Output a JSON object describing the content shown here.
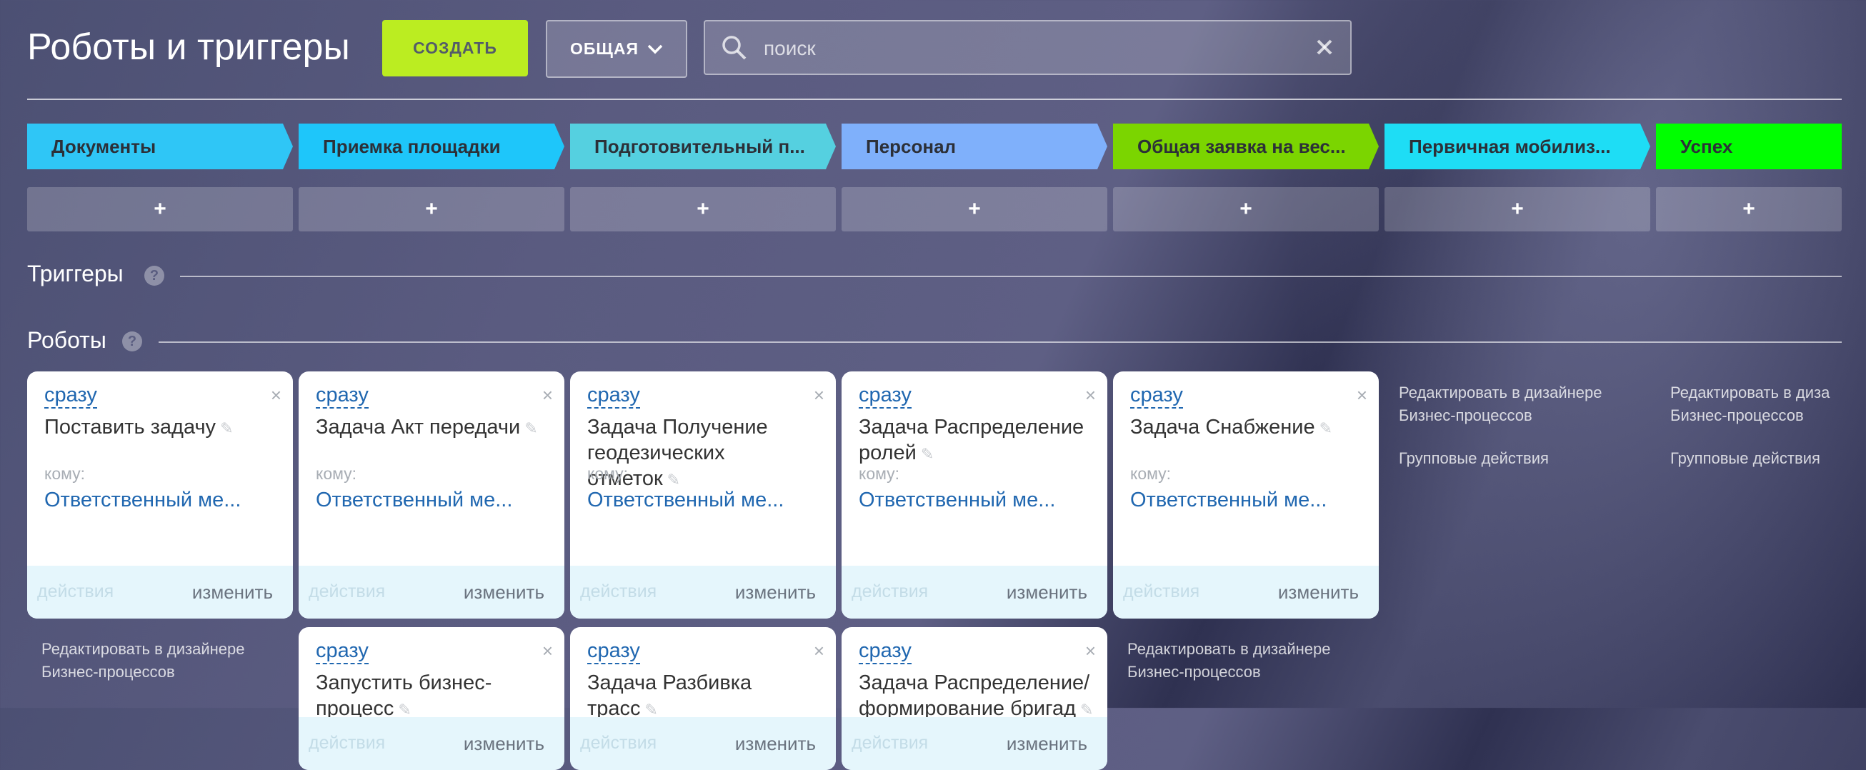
{
  "header": {
    "title": "Роботы и триггеры",
    "create_label": "СОЗДАТЬ",
    "general_label": "ОБЩАЯ",
    "search_placeholder": "поиск"
  },
  "stages": [
    {
      "label": "Документы",
      "color": "#2fc6f6"
    },
    {
      "label": "Приемка площадки",
      "color": "#1ec6fa"
    },
    {
      "label": "Подготовительный п...",
      "color": "#55d0e0"
    },
    {
      "label": "Персонал",
      "color": "#7fb0fb"
    },
    {
      "label": "Общая заявка на вес...",
      "color": "#7bd500"
    },
    {
      "label": "Первичная мобилиз...",
      "color": "#1eddf5"
    },
    {
      "label": "Успех",
      "color": "#00ff00"
    }
  ],
  "add_label": "+",
  "sections": {
    "triggers": "Триггеры",
    "robots": "Роботы",
    "help": "?"
  },
  "card_common": {
    "when": "сразу",
    "to_label": "кому:",
    "responsible": "Ответственный ме...",
    "actions": "действия",
    "edit": "изменить",
    "close": "×"
  },
  "robots_row1": [
    {
      "name": "Поставить задачу"
    },
    {
      "name": "Задача Акт передачи"
    },
    {
      "name": "Задача Получение геодезических отметок"
    },
    {
      "name": "Задача Распределение ролей"
    },
    {
      "name": "Задача Снабжение"
    }
  ],
  "robots_row2": [
    {
      "name": "Запустить бизнес-процесс"
    },
    {
      "name": "Задача Разбивка трасс"
    },
    {
      "name": "Задача Распределение/формирование бригад"
    }
  ],
  "side_links": {
    "edit_designer_line1": "Редактировать в дизайнере",
    "edit_designer_line2": "Бизнес-процессов",
    "edit_designer_cut": "Редактировать в диза",
    "group_actions": "Групповые действия"
  },
  "colors": {
    "accent": "#bbed21",
    "link": "#2067b0"
  }
}
